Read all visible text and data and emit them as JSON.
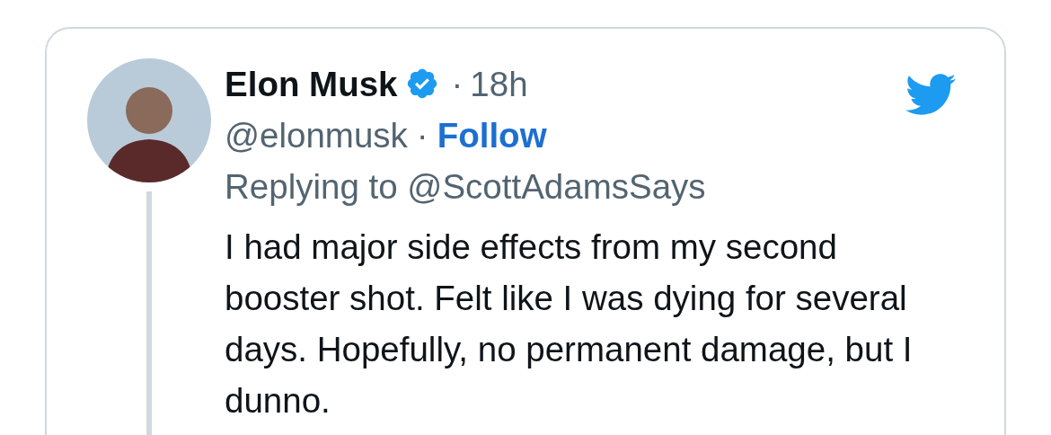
{
  "tweet": {
    "author": {
      "name": "Elon Musk",
      "verified": true,
      "handle": "@elonmusk"
    },
    "time_separator": "·",
    "time": "18h",
    "follow_separator": "·",
    "follow": "Follow",
    "replying_to": "Replying to @ScottAdamsSays",
    "text": "I had major side effects from my second booster shot. Felt like I was dying for several days. Hopefully, no permanent damage, but I dunno.",
    "thread_line": true
  }
}
